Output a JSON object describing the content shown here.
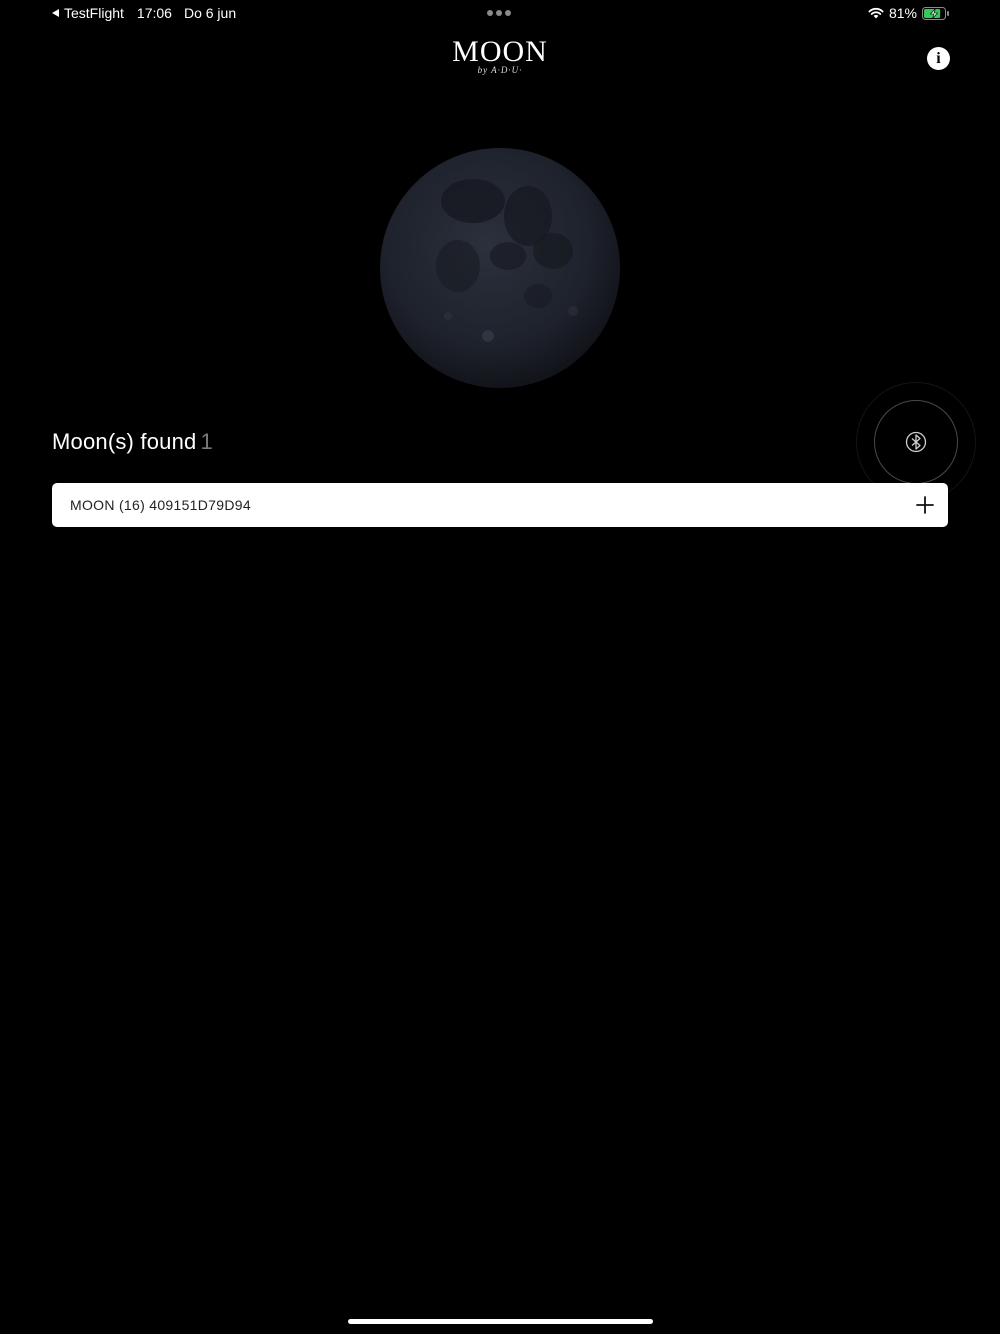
{
  "status_bar": {
    "back_app": "TestFlight",
    "time": "17:06",
    "date": "Do 6 jun",
    "battery_percent": "81%",
    "battery_level": 0.81
  },
  "logo": {
    "main": "MOON",
    "sub": "by A·D·U·"
  },
  "found": {
    "label": "Moon(s) found",
    "count": "1"
  },
  "devices": [
    {
      "name": "MOON (16) 409151D79D94",
      "action_icon": "plus-icon"
    }
  ],
  "icons": {
    "info": "info-icon",
    "scan": "bluetooth-icon",
    "wifi": "wifi-icon",
    "battery": "battery-charging-icon"
  },
  "colors": {
    "background": "#000000",
    "text": "#ffffff",
    "muted": "#7a7a7a",
    "battery_fill": "#34c759"
  }
}
